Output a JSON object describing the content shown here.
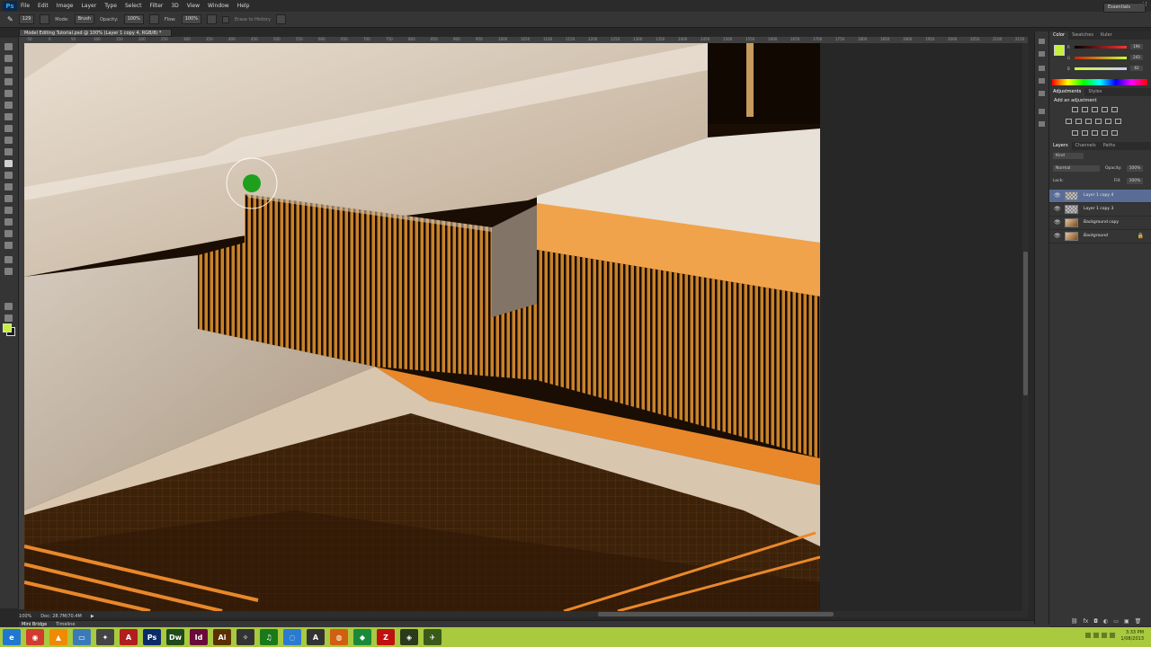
{
  "app": {
    "logo": "Ps"
  },
  "menu": [
    "File",
    "Edit",
    "Image",
    "Layer",
    "Type",
    "Select",
    "Filter",
    "3D",
    "View",
    "Window",
    "Help"
  ],
  "window_controls": [
    "–",
    "▫",
    "✕"
  ],
  "options_bar": {
    "size": "129",
    "mode_label": "Mode:",
    "mode_value": "Brush",
    "opacity_label": "Opacity:",
    "opacity_value": "100%",
    "flow_label": "Flow:",
    "flow_value": "100%",
    "erase_to_history": "Erase to History",
    "workspace": "Essentials"
  },
  "document": {
    "tab_title": "Model Editing Tutorial.psd @ 100% (Layer 1 copy 4, RGB/8) *",
    "ruler_ticks": [
      "-50",
      "0",
      "50",
      "100",
      "150",
      "200",
      "250",
      "300",
      "350",
      "400",
      "450",
      "500",
      "550",
      "600",
      "650",
      "700",
      "750",
      "800",
      "850",
      "900",
      "950",
      "1000",
      "1050",
      "1100",
      "1150",
      "1200",
      "1250",
      "1300",
      "1350",
      "1400",
      "1450",
      "1500",
      "1550",
      "1600",
      "1650",
      "1700",
      "1750",
      "1800",
      "1850",
      "1900",
      "1950",
      "2000",
      "2050",
      "2100",
      "2150"
    ],
    "status_zoom": "100%",
    "status_doc": "Doc: 28.7M/70.4M"
  },
  "bottom_tabs": [
    "Mini Bridge",
    "Timeline"
  ],
  "color_panel": {
    "tabs": [
      "Color",
      "Swatches",
      "Kuler"
    ],
    "channels": [
      {
        "label": "R",
        "value": "194",
        "color": "#ff5050"
      },
      {
        "label": "G",
        "value": "243",
        "color": "#50ff50"
      },
      {
        "label": "B",
        "value": "63",
        "color": "#5070ff"
      }
    ],
    "foreground": "#c6f03c"
  },
  "adjustments_panel": {
    "tabs": [
      "Adjustments",
      "Styles"
    ],
    "heading": "Add an adjustment"
  },
  "layers_panel": {
    "tabs": [
      "Layers",
      "Channels",
      "Paths"
    ],
    "filter_kind": "Kind",
    "blend_mode": "Normal",
    "opacity_label": "Opacity:",
    "opacity_value": "100%",
    "lock_label": "Lock:",
    "fill_label": "Fill:",
    "fill_value": "100%",
    "layers": [
      {
        "name": "Layer 1 copy 4",
        "selected": true,
        "thumb": "checker"
      },
      {
        "name": "Layer 1 copy 3",
        "selected": false,
        "thumb": "checker"
      },
      {
        "name": "Background copy",
        "selected": false,
        "thumb": "photo"
      },
      {
        "name": "Background",
        "selected": false,
        "thumb": "photo"
      }
    ]
  },
  "taskbar": {
    "apps": [
      {
        "name": "ie",
        "glyph": "e",
        "color": "#1e78d0"
      },
      {
        "name": "chrome",
        "glyph": "◉",
        "color": "#d23b2f"
      },
      {
        "name": "vlc",
        "glyph": "▲",
        "color": "#f08a00"
      },
      {
        "name": "folder",
        "glyph": "▭",
        "color": "#3a7ab8"
      },
      {
        "name": "app",
        "glyph": "✦",
        "color": "#444"
      },
      {
        "name": "acrobat",
        "glyph": "A",
        "color": "#b01e1e"
      },
      {
        "name": "photoshop",
        "glyph": "Ps",
        "color": "#0b2a6a"
      },
      {
        "name": "dreamweaver",
        "glyph": "Dw",
        "color": "#1f4a1a"
      },
      {
        "name": "indesign",
        "glyph": "Id",
        "color": "#6a0a3a"
      },
      {
        "name": "illustrator",
        "glyph": "Ai",
        "color": "#5a3000"
      },
      {
        "name": "app2",
        "glyph": "✧",
        "color": "#333"
      },
      {
        "name": "spotify",
        "glyph": "♫",
        "color": "#1a7a1a"
      },
      {
        "name": "app3",
        "glyph": "◌",
        "color": "#2a7ad0"
      },
      {
        "name": "app4",
        "glyph": "A",
        "color": "#333"
      },
      {
        "name": "firefox",
        "glyph": "◍",
        "color": "#d06010"
      },
      {
        "name": "app5",
        "glyph": "◆",
        "color": "#1a8a3a"
      },
      {
        "name": "filezilla",
        "glyph": "Z",
        "color": "#c01010"
      },
      {
        "name": "app6",
        "glyph": "◈",
        "color": "#2a3a1a"
      },
      {
        "name": "app7",
        "glyph": "✈",
        "color": "#3a5a1a"
      }
    ],
    "time": "3:33 PM",
    "date": "1/08/2013"
  }
}
